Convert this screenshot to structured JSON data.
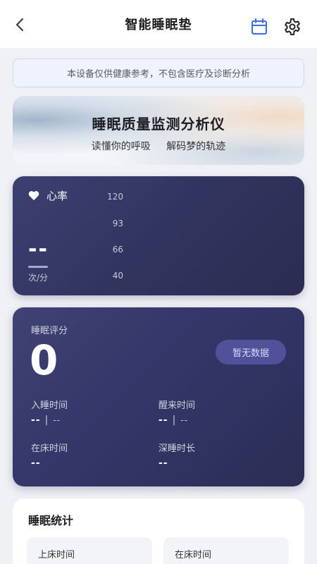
{
  "header": {
    "title": "智能睡眠垫",
    "back_icon": "chevron-left-icon",
    "calendar_icon": "calendar-icon",
    "settings_icon": "gear-icon",
    "accent_color": "#3b6fe0"
  },
  "notice": {
    "text": "本设备仅供健康参考，不包含医疗及诊断分析"
  },
  "banner": {
    "title": "睡眠质量监测分析仪",
    "subtitle_left": "读懂你的呼吸",
    "subtitle_right": "解码梦的轨迹"
  },
  "heart_rate": {
    "label": "心率",
    "icon": "heart-icon",
    "value": "--",
    "unit": "次/分",
    "axis_ticks": [
      "120",
      "93",
      "66",
      "40"
    ],
    "card_color": "#363866"
  },
  "sleep_score": {
    "label": "睡眠评分",
    "value": "0",
    "badge": "暂无数据",
    "items": [
      {
        "label": "入睡时间",
        "value": "--",
        "sub": "--"
      },
      {
        "label": "醒来时间",
        "value": "--",
        "sub": "--"
      },
      {
        "label": "在床时间",
        "value": "--"
      },
      {
        "label": "深睡时长",
        "value": "--"
      }
    ]
  },
  "stats": {
    "title": "睡眠统计",
    "tiles": [
      {
        "label": "上床时间"
      },
      {
        "label": "在床时间"
      }
    ]
  }
}
